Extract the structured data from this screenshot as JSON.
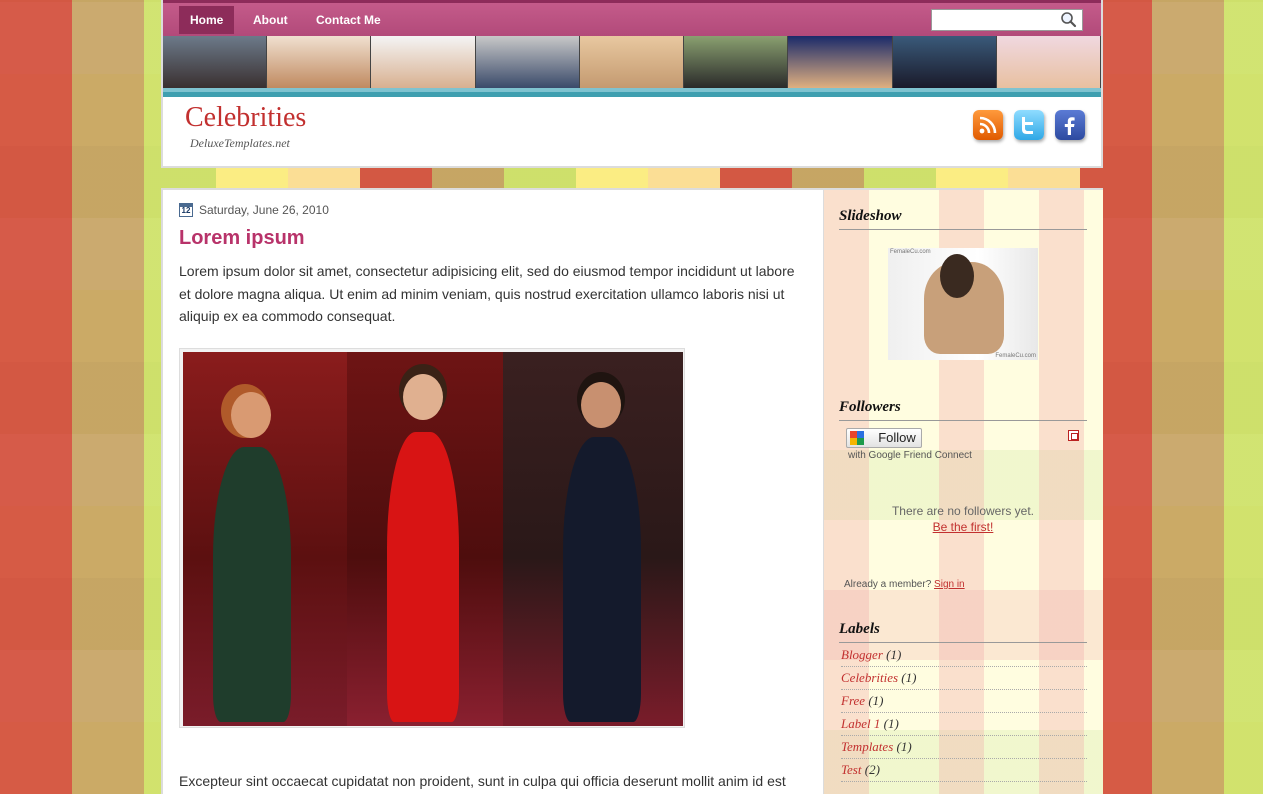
{
  "nav": {
    "items": [
      {
        "label": "Home",
        "active": true
      },
      {
        "label": "About",
        "active": false
      },
      {
        "label": "Contact Me",
        "active": false
      }
    ],
    "search_value": "",
    "search_icon": "magnifier-icon"
  },
  "header": {
    "title": "Celebrities",
    "subtitle": "DeluxeTemplates.net",
    "social": [
      "rss-icon",
      "twitter-icon",
      "facebook-icon"
    ]
  },
  "post": {
    "date": "Saturday, June 26, 2010",
    "calendar_icon_text": "12",
    "title": "Lorem ipsum",
    "paragraph1": "Lorem ipsum dolor sit amet, consectetur adipisicing elit, sed do eiusmod tempor incididunt ut labore et dolore magna aliqua. Ut enim ad minim veniam, quis nostrud exercitation ullamco laboris nisi ut aliquip ex ea commodo consequat.",
    "paragraph2": "Excepteur sint occaecat cupidatat non proident, sunt in culpa qui officia deserunt mollit anim id est laborum."
  },
  "sidebar": {
    "slideshow": {
      "title": "Slideshow",
      "caption": "FemaleCu.com"
    },
    "followers": {
      "title": "Followers",
      "follow_label": "Follow",
      "gfc_text": "with Google Friend Connect",
      "no_followers": "There are no followers yet.",
      "be_first": "Be the first!",
      "already_member": "Already a member?",
      "sign_in": "Sign in"
    },
    "labels": {
      "title": "Labels",
      "items": [
        {
          "name": "Blogger",
          "count": "(1)"
        },
        {
          "name": "Celebrities",
          "count": "(1)"
        },
        {
          "name": "Free",
          "count": "(1)"
        },
        {
          "name": "Label 1",
          "count": "(1)"
        },
        {
          "name": "Templates",
          "count": "(1)"
        },
        {
          "name": "Test",
          "count": "(2)"
        }
      ]
    }
  },
  "colors": {
    "accent": "#b8336a",
    "nav_bar": "#c45b8a",
    "title_red": "#c2302f",
    "link_red": "#c2302f"
  }
}
